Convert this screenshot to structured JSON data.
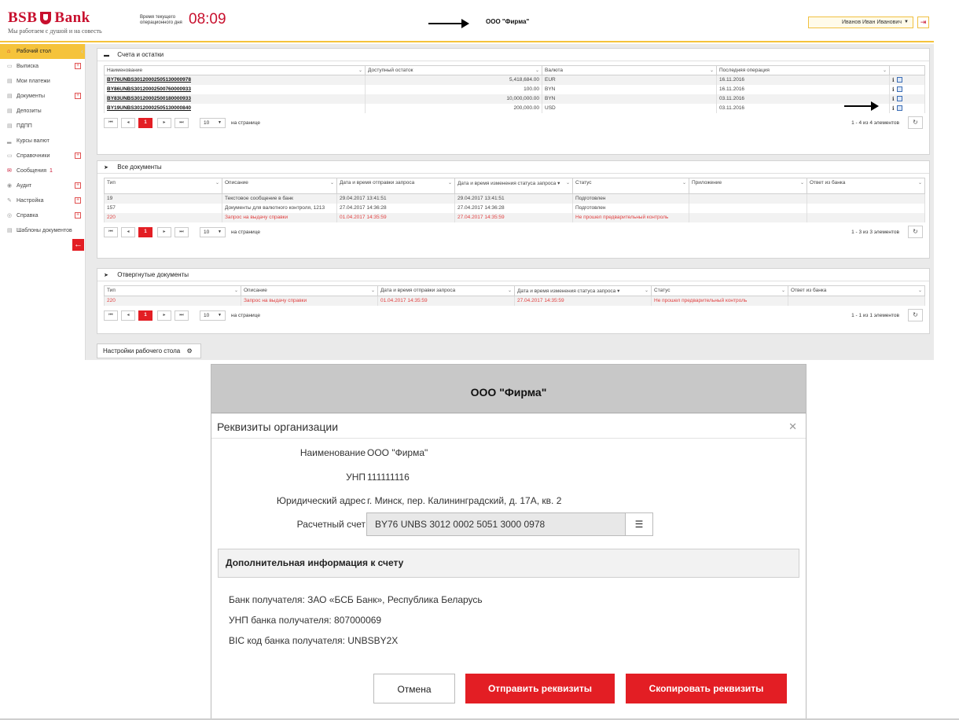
{
  "header": {
    "bank_name_left": "BSB",
    "bank_name_right": "Bank",
    "slogan": "Мы работаем с душой и на совесть",
    "op_time_label": "Время текущего операционного дня",
    "op_time": "08:09",
    "firm": "ООО \"Фирма\"",
    "user": "Иванов Иван Иванович",
    "colors": {
      "brand": "#c8102e",
      "accent": "#f5c33b"
    }
  },
  "sidebar": {
    "items": [
      {
        "label": "Рабочий стол",
        "icon": "home-icon",
        "glyph": "⌂"
      },
      {
        "label": "Выписка",
        "icon": "statement-icon",
        "glyph": "▭"
      },
      {
        "label": "Мои платежи",
        "icon": "payments-icon",
        "glyph": "▤"
      },
      {
        "label": "Документы",
        "icon": "documents-icon",
        "glyph": "▤"
      },
      {
        "label": "Депозиты",
        "icon": "deposits-icon",
        "glyph": "▤"
      },
      {
        "label": "ПДПП",
        "icon": "pdpp-icon",
        "glyph": "▤"
      },
      {
        "label": "Курсы валют",
        "icon": "rates-icon",
        "glyph": "▂"
      },
      {
        "label": "Справочники",
        "icon": "directories-icon",
        "glyph": "▭"
      },
      {
        "label": "Сообщения",
        "icon": "messages-icon",
        "glyph": "✉",
        "badge": "1"
      },
      {
        "label": "Аудит",
        "icon": "audit-icon",
        "glyph": "◉"
      },
      {
        "label": "Настройка",
        "icon": "settings-icon",
        "glyph": "✎"
      },
      {
        "label": "Справка",
        "icon": "help-icon",
        "glyph": "◎"
      },
      {
        "label": "Шаблоны документов",
        "icon": "templates-icon",
        "glyph": "▤"
      }
    ]
  },
  "accounts": {
    "title": "Счета и остатки",
    "columns": [
      "Наименование",
      "Доступный остаток",
      "Валюта",
      "Последняя операция"
    ],
    "rows": [
      {
        "account": "BY76UNBS30120002505130000978",
        "balance": "5,418,684.00",
        "currency": "EUR",
        "last_op": "16.11.2016"
      },
      {
        "account": "BY86UNBS30120002500760000933",
        "balance": "100.00",
        "currency": "BYN",
        "last_op": "16.11.2016"
      },
      {
        "account": "BY83UNBS30120002500180000933",
        "balance": "10,000,000.00",
        "currency": "BYN",
        "last_op": "03.11.2016"
      },
      {
        "account": "BY19UNBS30120002505130000840",
        "balance": "200,000.00",
        "currency": "USD",
        "last_op": "03.11.2016"
      }
    ],
    "pager": {
      "page": "1",
      "size": "10",
      "per_page_label": "на странице",
      "info": "1 - 4 из 4 элементов"
    }
  },
  "all_docs": {
    "title": "Все документы",
    "columns": [
      "Тип",
      "Описание",
      "Дата и время отправки запроса",
      "Дата и время изменения статуса запроса",
      "Статус",
      "Приложение",
      "Ответ из банка"
    ],
    "rows": [
      {
        "type": "19",
        "desc": "Текстовое сообщение в банк",
        "sent": "29.04.2017 13:41:51",
        "changed": "29.04.2017 13:41:51",
        "status": "Подготовлен",
        "attach": "",
        "answer": "",
        "rejected": false
      },
      {
        "type": "157",
        "desc": "Документы для валютного контроля, 1213",
        "sent": "27.04.2017 14:36:28",
        "changed": "27.04.2017 14:36:28",
        "status": "Подготовлен",
        "attach": "",
        "answer": "",
        "rejected": false
      },
      {
        "type": "220",
        "desc": "Запрос на выдачу справки",
        "sent": "01.04.2017 14:35:59",
        "changed": "27.04.2017 14:35:59",
        "status": "Не прошел предварительный контроль",
        "attach": "",
        "answer": "",
        "rejected": true
      }
    ],
    "pager": {
      "page": "1",
      "size": "10",
      "per_page_label": "на странице",
      "info": "1 - 3 из 3 элементов"
    }
  },
  "rejected_docs": {
    "title": "Отвергнутые документы",
    "columns": [
      "Тип",
      "Описание",
      "Дата и время отправки запроса",
      "Дата и время изменения статуса запроса",
      "Статус",
      "Ответ из банка"
    ],
    "rows": [
      {
        "type": "220",
        "desc": "Запрос на выдачу справки",
        "sent": "01.04.2017 14:35:59",
        "changed": "27.04.2017 14:35:59",
        "status": "Не прошел предварительный контроль",
        "answer": ""
      }
    ],
    "pager": {
      "page": "1",
      "size": "10",
      "per_page_label": "на странице",
      "info": "1 - 1 из 1 элементов"
    }
  },
  "settings_button": "Настройки рабочего стола",
  "modal": {
    "top_title": "ООО \"Фирма\"",
    "title": "Реквизиты организации",
    "fields": {
      "name_label": "Наименование",
      "name_value": "ООО \"Фирма\"",
      "unp_label": "УНП",
      "unp_value": "111111116",
      "address_label": "Юридический адрес",
      "address_value": "г. Минск, пер. Калининградский, д. 17А, кв. 2",
      "account_label": "Расчетный счет",
      "account_value": "BY76 UNBS 3012 0002 5051 3000 0978"
    },
    "add_info_title": "Дополнительная информация к счету",
    "info_lines": [
      "Банк получателя: ЗАО «БСБ Банк», Республика Беларусь",
      "УНП банка получателя: 807000069",
      "BIC код банка получателя: UNBSBY2X"
    ],
    "buttons": {
      "cancel": "Отмена",
      "send": "Отправить реквизиты",
      "copy": "Скопировать реквизиты"
    }
  }
}
